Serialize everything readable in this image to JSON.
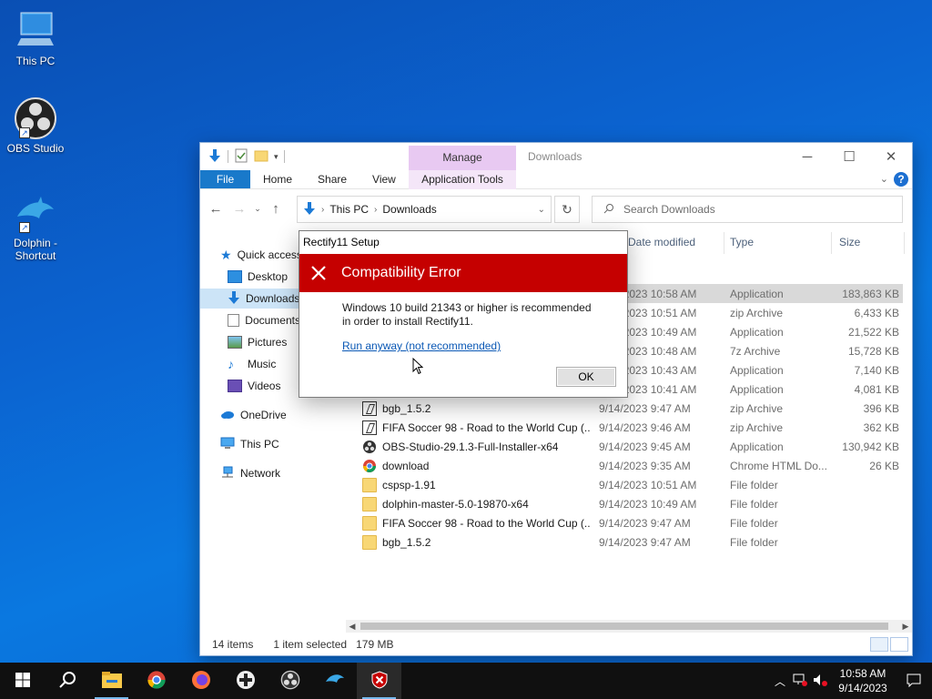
{
  "desktop": {
    "icons": [
      {
        "label": "This PC"
      },
      {
        "label": "OBS Studio"
      },
      {
        "label": "Dolphin - Shortcut"
      }
    ]
  },
  "explorer": {
    "title": "Downloads",
    "manage_tab": "Manage",
    "ribbon_tabs": [
      "File",
      "Home",
      "Share",
      "View"
    ],
    "app_tools_tab": "Application Tools",
    "breadcrumb": [
      "This PC",
      "Downloads"
    ],
    "search_placeholder": "Search Downloads",
    "nav": {
      "quick_access": "Quick access",
      "items": [
        "Desktop",
        "Downloads",
        "Documents",
        "Pictures",
        "Music",
        "Videos"
      ],
      "onedrive": "OneDrive",
      "this_pc": "This PC",
      "network": "Network"
    },
    "columns": {
      "date": "Date modified",
      "type": "Type",
      "size": "Size"
    },
    "partial_rows": [
      {
        "date": "9/14/2023 10:58 AM",
        "type": "Application",
        "size": "183,863 KB"
      },
      {
        "date": "9/14/2023 10:51 AM",
        "type": "zip Archive",
        "size": "6,433 KB"
      },
      {
        "date": "9/14/2023 10:49 AM",
        "type": "Application",
        "size": "21,522 KB"
      },
      {
        "date": "9/14/2023 10:48 AM",
        "type": "7z Archive",
        "size": "15,728 KB"
      },
      {
        "date": "9/14/2023 10:43 AM",
        "type": "Application",
        "size": "7,140 KB"
      },
      {
        "date": "9/14/2023 10:41 AM",
        "type": "Application",
        "size": "4,081 KB"
      }
    ],
    "rows": [
      {
        "name": "bgb_1.5.2",
        "date": "9/14/2023 9:47 AM",
        "type": "zip Archive",
        "size": "396 KB"
      },
      {
        "name": "FIFA Soccer 98 - Road to the World Cup (...",
        "date": "9/14/2023 9:46 AM",
        "type": "zip Archive",
        "size": "362 KB"
      },
      {
        "name": "OBS-Studio-29.1.3-Full-Installer-x64",
        "date": "9/14/2023 9:45 AM",
        "type": "Application",
        "size": "130,942 KB"
      },
      {
        "name": "download",
        "date": "9/14/2023 9:35 AM",
        "type": "Chrome HTML Do...",
        "size": "26 KB"
      },
      {
        "name": "cspsp-1.91",
        "date": "9/14/2023 10:51 AM",
        "type": "File folder",
        "size": ""
      },
      {
        "name": "dolphin-master-5.0-19870-x64",
        "date": "9/14/2023 10:49 AM",
        "type": "File folder",
        "size": ""
      },
      {
        "name": "FIFA Soccer 98 - Road to the World Cup (...",
        "date": "9/14/2023 9:47 AM",
        "type": "File folder",
        "size": ""
      },
      {
        "name": "bgb_1.5.2",
        "date": "9/14/2023 9:47 AM",
        "type": "File folder",
        "size": ""
      }
    ],
    "status": {
      "items": "14 items",
      "selected": "1 item selected",
      "size": "179 MB"
    }
  },
  "dialog": {
    "title": "Rectify11 Setup",
    "heading": "Compatibility Error",
    "message": "Windows 10 build 21343 or higher is recommended in order to install Rectify11.",
    "link": "Run anyway (not recommended)",
    "ok": "OK"
  },
  "taskbar": {
    "time": "10:58 AM",
    "date": "9/14/2023"
  },
  "colors": {
    "accent": "#1979ca",
    "error_banner": "#c50000",
    "manage": "#e8c9f2"
  }
}
